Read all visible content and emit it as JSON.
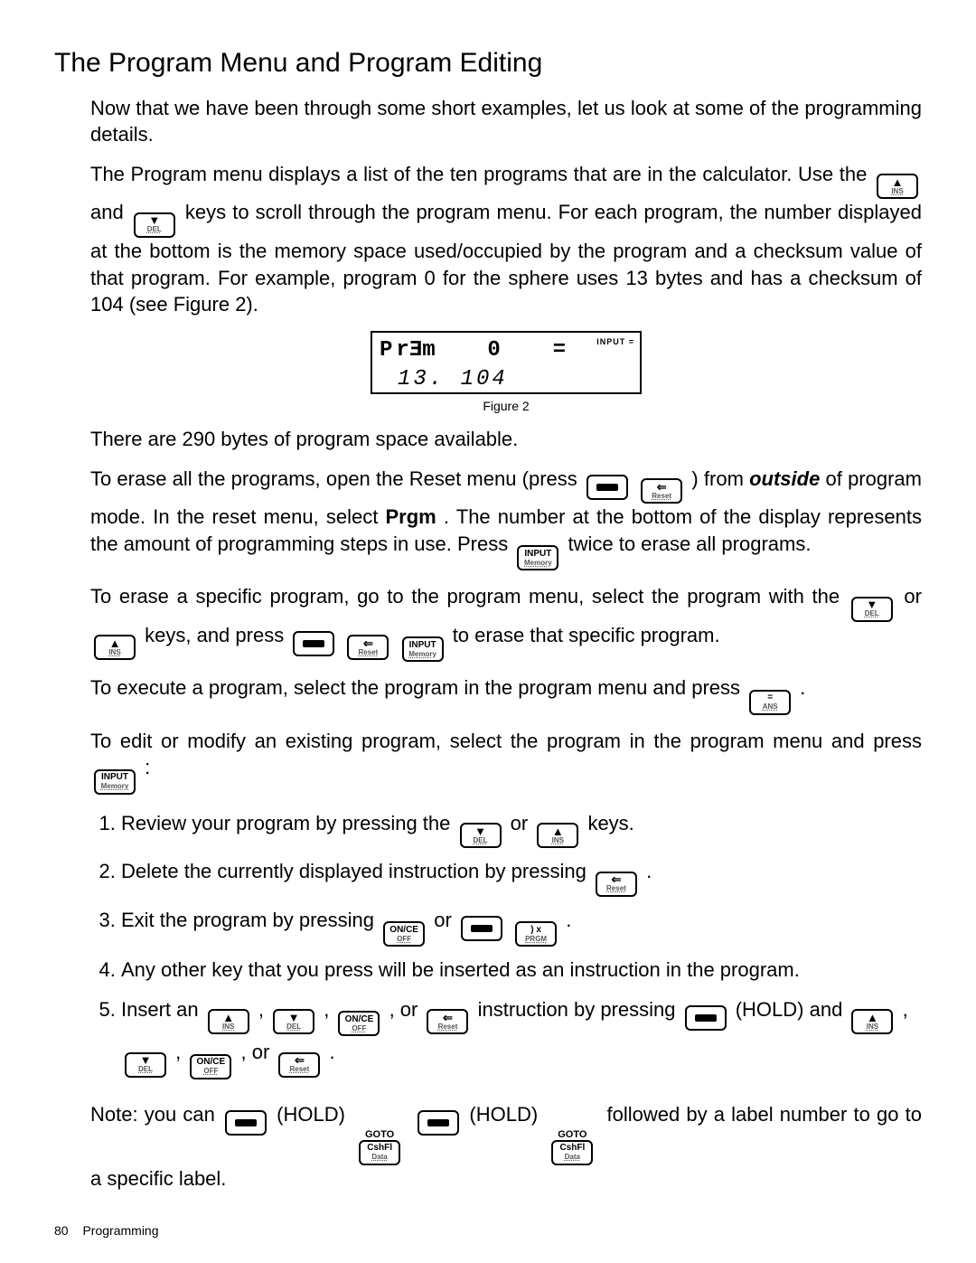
{
  "title": "The Program Menu and Program Editing",
  "intro": "Now that we have been through some short examples, let us look at some of the programming details.",
  "p2a": "The Program menu displays a list of the ten programs that are in the calculator. Use the ",
  "p2b": " and ",
  "p2c": " keys to scroll through the program menu. For each program, the number displayed at the bottom is the memory space used/occupied by the program and a checksum value of that program. For example, program 0 for the sphere uses 13 bytes and has a checksum of 104 (see Figure 2).",
  "lcd": {
    "line1_a": "P",
    "line1_b": "r",
    "line1_c": "9",
    "line1_d": "m",
    "line1_e": "0",
    "line1_f": "=",
    "line2": "13. 104",
    "annun": "INPUT  ="
  },
  "fig_caption": "Figure 2",
  "p290": "There are 290 bytes of program space available.",
  "p3a": "To erase all the programs, open the Reset menu (press ",
  "p3b": ") from ",
  "p3c": "outside",
  "p3d": " of program mode. In the reset menu, select ",
  "p3e": "Prgm",
  "p3f": ". The number at the bottom of the display represents the amount of programming steps in use. Press ",
  "p3g": " twice to erase all programs.",
  "p4a": "To erase a specific program, go to the program menu, select the program with the ",
  "p4b": " or ",
  "p4c": " keys, and press ",
  "p4d": " to erase that specific program.",
  "p5a": "To execute a program, select the program in the program menu and press ",
  "p5b": ".",
  "p6a": "To edit or modify an existing program, select the program in the program menu and press ",
  "p6b": ":",
  "steps": {
    "1a": "Review your program by pressing the ",
    "1b": " or ",
    "1c": " keys.",
    "2a": "Delete the currently displayed instruction by pressing ",
    "2b": ".",
    "3a": "Exit the program by pressing ",
    "3b": " or ",
    "3c": ".",
    "4": "Any other key that you press will be inserted as an instruction in the program.",
    "5a": "Insert an ",
    "5b": ", ",
    "5c": ", ",
    "5d": ", or ",
    "5e": " instruction by pressing ",
    "5f": " (HOLD) and ",
    "5g": ", ",
    "5h": ", ",
    "5i": ", or ",
    "5j": "."
  },
  "notea": "Note: you can ",
  "holdtxt": "(HOLD)",
  "goto": "GOTO",
  "noteb": " followed by a label number to go to a specific label.",
  "keys": {
    "up_ins": {
      "top": "▲",
      "bot": "INS"
    },
    "down_del": {
      "top": "▼",
      "bot": "DEL"
    },
    "shift": {
      "top": "",
      "bot": ""
    },
    "left_reset": {
      "top": "⇐",
      "bot": "Reset"
    },
    "input_mem": {
      "top": "INPUT",
      "bot": "Memory"
    },
    "eq_ans": {
      "top": "=",
      "bot": "ANS"
    },
    "once_off": {
      "top": "ON/CE",
      "bot": "OFF"
    },
    "rpar_prgm": {
      "top": ") x",
      "bot": "PRGM"
    },
    "cshfl_data": {
      "top": "CshFl",
      "bot": "Data"
    }
  },
  "footer": {
    "page": "80",
    "section": "Programming"
  }
}
